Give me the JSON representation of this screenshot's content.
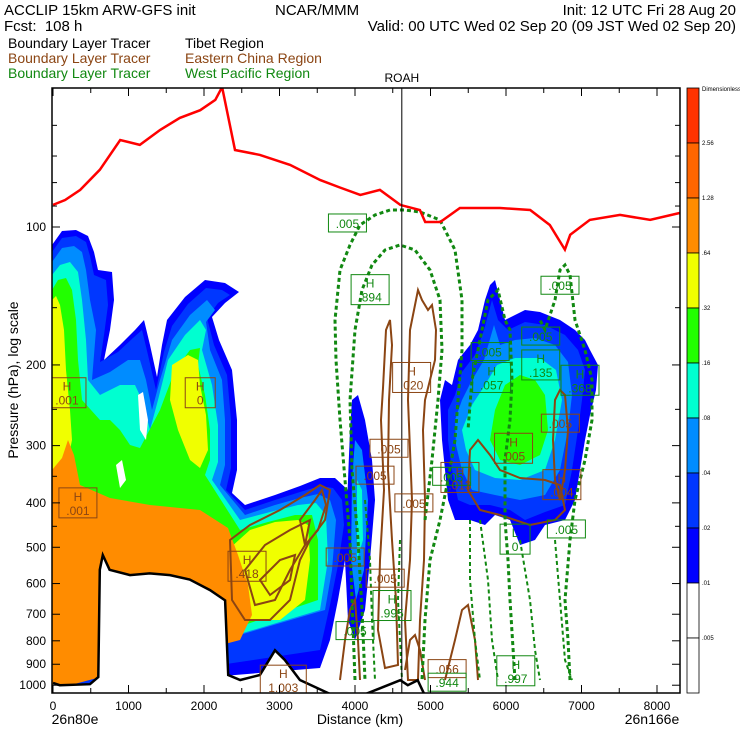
{
  "header": {
    "model": "ACCLIP 15km ARW-GFS init",
    "org": "NCAR/MMM",
    "init": "Init: 12 UTC Fri 28 Aug 20",
    "fcst": "Fcst:  108 h",
    "valid": "Valid: 00 UTC Wed 02 Sep 20 (09 JST Wed 02 Sep 20)"
  },
  "legend": [
    {
      "tracer": "Boundary Layer Tracer",
      "region": "Tibet Region",
      "color": "#000000"
    },
    {
      "tracer": "Boundary Layer Tracer",
      "region": "Eastern China Region",
      "color": "#8b4513"
    },
    {
      "tracer": "Boundary Layer Tracer",
      "region": "West Pacific Region",
      "color": "#118811"
    }
  ],
  "chart_data": {
    "type": "cross-section",
    "xlabel": "Distance (km)",
    "ylabel": "Pressure (hPa), log scale",
    "xlim": [
      0,
      8300
    ],
    "ylim": [
      50,
      1070
    ],
    "yscale": "log",
    "x_ticks": [
      0,
      1000,
      2000,
      3000,
      4000,
      5000,
      6000,
      7000,
      8000
    ],
    "y_ticks": [
      100,
      200,
      300,
      400,
      500,
      600,
      700,
      800,
      900,
      1000
    ],
    "start_point": "26n80e",
    "end_point": "26n166e",
    "station": {
      "name": "ROAH",
      "km": 4620
    },
    "colorbar": {
      "units": "Dimensionless",
      "levels": [
        "2.56",
        "1.28",
        ".64",
        ".32",
        ".16",
        ".08",
        ".04",
        ".02",
        ".01",
        ".005"
      ],
      "colors": [
        "#ff3300",
        "#ff6600",
        "#ff8c00",
        "#f0ff00",
        "#22ff00",
        "#00ffd0",
        "#008cff",
        "#0037ff",
        "#0000ff",
        "#ffffff",
        "#ffffff"
      ]
    },
    "tropopause": {
      "color": "#ff0000",
      "km": [
        0,
        160,
        360,
        620,
        890,
        1150,
        1420,
        1680,
        1950,
        2150,
        2240,
        2410,
        2740,
        3140,
        3540,
        3800,
        4070,
        4330,
        4600,
        4860,
        4930,
        5130,
        5390,
        5920,
        6320,
        6580,
        6780,
        6850,
        7110,
        7510,
        7910,
        8300
      ],
      "p": [
        89.5,
        87.3,
        83,
        75,
        64.6,
        66.2,
        61.4,
        57.8,
        55.6,
        52.8,
        49.5,
        67.9,
        69.6,
        73.2,
        79,
        82,
        85.1,
        83,
        89.5,
        91.8,
        97.5,
        97.5,
        90.9,
        90.9,
        91.8,
        99,
        112,
        104,
        96.5,
        94.1,
        96.5,
        93.2
      ]
    },
    "terrain": {
      "color": "#000000",
      "km": [
        0,
        90,
        490,
        600,
        620,
        660,
        750,
        1020,
        1280,
        1550,
        1810,
        2080,
        2280,
        2320,
        2480,
        2740,
        2940,
        3070,
        3270,
        3670,
        4070,
        4600,
        4700,
        4830,
        4930,
        5920,
        7250,
        8300
      ],
      "p": [
        989,
        1000,
        995,
        960,
        560,
        520,
        560,
        575,
        570,
        575,
        588,
        620,
        653,
        950,
        974,
        950,
        839,
        881,
        974,
        1045,
        1056,
        975,
        1000,
        975,
        1056,
        1062,
        1062,
        1062
      ]
    },
    "contour_labels": [
      {
        "kind": "H",
        "value": ".001",
        "tracer": "eastern-china",
        "km": 185,
        "p": 230
      },
      {
        "kind": "H",
        "value": ".001",
        "tracer": "eastern-china",
        "km": 330,
        "p": 400
      },
      {
        "kind": "H",
        "value": "0",
        "tracer": "eastern-china",
        "km": 1950,
        "p": 230
      },
      {
        "kind": "H",
        "value": ".020",
        "tracer": "eastern-china",
        "km": 4750,
        "p": 213
      },
      {
        "kind": "",
        "value": ".005",
        "tracer": "eastern-china",
        "km": 4450,
        "p": 304
      },
      {
        "kind": "",
        "value": ".005",
        "tracer": "eastern-china",
        "km": 4265,
        "p": 348
      },
      {
        "kind": "",
        "value": ".005",
        "tracer": "eastern-china",
        "km": 4780,
        "p": 400
      },
      {
        "kind": "H",
        "value": ".418",
        "tracer": "eastern-china",
        "km": 2570,
        "p": 550
      },
      {
        "kind": "",
        "value": ".005",
        "tracer": "eastern-china",
        "km": 3870,
        "p": 525
      },
      {
        "kind": "",
        "value": ".005",
        "tracer": "eastern-china",
        "km": 4400,
        "p": 584
      },
      {
        "kind": "H",
        "value": "1.003",
        "tracer": "eastern-china",
        "km": 3050,
        "p": 975
      },
      {
        "kind": "",
        "value": ".056",
        "tracer": "eastern-china",
        "km": 5220,
        "p": 920
      },
      {
        "kind": "H",
        "value": ".005",
        "tracer": "eastern-china",
        "km": 6100,
        "p": 304
      },
      {
        "kind": "",
        "value": ".005",
        "tracer": "eastern-china",
        "km": 6720,
        "p": 268
      },
      {
        "kind": "H",
        "value": ".004",
        "tracer": "eastern-china",
        "km": 6740,
        "p": 365
      },
      {
        "kind": "H",
        "value": ".013",
        "tracer": "eastern-china",
        "km": 5390,
        "p": 352
      },
      {
        "kind": "",
        "value": ".005",
        "tracer": "west-pacific",
        "km": 3900,
        "p": 98
      },
      {
        "kind": "H",
        "value": ".894",
        "tracer": "west-pacific",
        "km": 4200,
        "p": 137
      },
      {
        "kind": "",
        "value": ".005",
        "tracer": "west-pacific",
        "km": 5790,
        "p": 187
      },
      {
        "kind": "H",
        "value": ".057",
        "tracer": "west-pacific",
        "km": 5810,
        "p": 213
      },
      {
        "kind": "",
        "value": ".005",
        "tracer": "west-pacific",
        "km": 6715,
        "p": 134
      },
      {
        "kind": "",
        "value": ".005",
        "tracer": "west-pacific",
        "km": 6460,
        "p": 173
      },
      {
        "kind": "H",
        "value": ".135",
        "tracer": "west-pacific",
        "km": 6460,
        "p": 200
      },
      {
        "kind": "H",
        "value": ".368",
        "tracer": "west-pacific",
        "km": 6980,
        "p": 216
      },
      {
        "kind": "",
        "value": ".005",
        "tracer": "west-pacific",
        "km": 5280,
        "p": 350
      },
      {
        "kind": "L",
        "value": "0",
        "tracer": "west-pacific",
        "km": 6120,
        "p": 480
      },
      {
        "kind": "",
        "value": ".005",
        "tracer": "west-pacific",
        "km": 6800,
        "p": 456
      },
      {
        "kind": "",
        "value": ".005",
        "tracer": "west-pacific",
        "km": 4000,
        "p": 760
      },
      {
        "kind": "H",
        "value": ".995",
        "tracer": "west-pacific",
        "km": 4490,
        "p": 670
      },
      {
        "kind": "H",
        "value": ".997",
        "tracer": "west-pacific",
        "km": 6130,
        "p": 930
      },
      {
        "kind": "",
        "value": ".944",
        "tracer": "west-pacific",
        "km": 5220,
        "p": 985
      }
    ]
  }
}
